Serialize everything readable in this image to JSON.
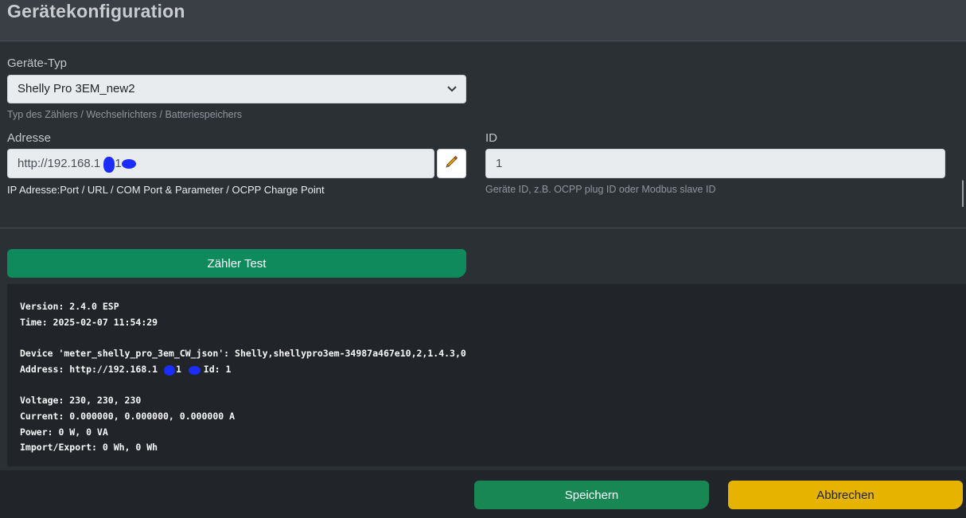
{
  "header": {
    "title": "Gerätekonfiguration"
  },
  "device_type": {
    "label": "Geräte-Typ",
    "selected": "Shelly Pro 3EM_new2",
    "help": "Typ des Zählers / Wechselrichters / Batteriespeichers"
  },
  "address": {
    "label": "Adresse",
    "value": "http://192.168.1",
    "value_tail": ".1",
    "help": "IP Adresse:Port / URL / COM Port & Parameter / OCPP Charge Point"
  },
  "id": {
    "label": "ID",
    "value": "1",
    "help": "Geräte ID, z.B. OCPP plug ID oder Modbus slave ID"
  },
  "test_button": {
    "label": "Zähler Test"
  },
  "test_output": {
    "lines": [
      "Version: 2.4.0 ESP",
      "Time: 2025-02-07 11:54:29",
      "",
      "Device 'meter_shelly_pro_3em_CW_json': Shelly,shellypro3em-34987a467e10,2,1.4.3,0",
      "Address: http://192.168.1",
      "",
      "Voltage: 230, 230, 230",
      "Current: 0.000000, 0.000000, 0.000000 A",
      "Power: 0 W, 0 VA",
      "Import/Export: 0 Wh, 0 Wh"
    ],
    "address_mid": ".1",
    "address_tail": ", Id: 1"
  },
  "footer": {
    "save_label": "Speichern",
    "cancel_label": "Abbrechen"
  },
  "colors": {
    "primary": "#198754",
    "warning": "#e6b400",
    "background": "#2b3035",
    "redaction": "#1a2cff"
  },
  "icons": {
    "edit": "pencil-icon",
    "select": "chevron-down-icon"
  }
}
